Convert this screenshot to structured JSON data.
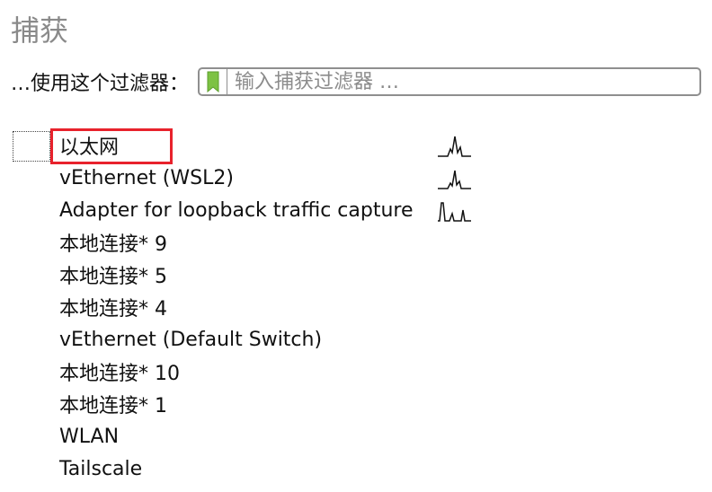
{
  "section": {
    "title": "捕获"
  },
  "filter": {
    "label": "…使用这个过滤器：",
    "placeholder": "输入捕获过滤器 …",
    "value": ""
  },
  "interfaces": [
    {
      "name": "以太网",
      "sparkline": "traffic-sparkline-icon"
    },
    {
      "name": "vEthernet (WSL2)",
      "sparkline": "traffic-sparkline-icon"
    },
    {
      "name": "Adapter for loopback traffic capture",
      "sparkline": "traffic-sparkline-icon"
    },
    {
      "name": "本地连接* 9"
    },
    {
      "name": "本地连接* 5"
    },
    {
      "name": "本地连接* 4"
    },
    {
      "name": "vEthernet (Default Switch)"
    },
    {
      "name": "本地连接* 10"
    },
    {
      "name": "本地连接* 1"
    },
    {
      "name": "WLAN"
    },
    {
      "name": "Tailscale"
    }
  ],
  "colors": {
    "highlight": "#e8222c",
    "bookmark": "#7dc243",
    "title": "#8a8a8a"
  }
}
